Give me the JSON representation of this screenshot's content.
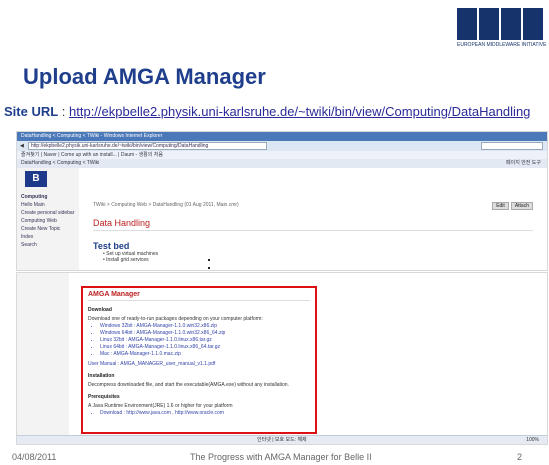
{
  "slide": {
    "title": "Upload AMGA Manager",
    "site_label": "Site URL",
    "site_sep": " : ",
    "site_url": "http://ekpbelle2.physik.uni-karlsruhe.de/~twiki/bin/view/Computing/DataHandling",
    "logo_text": "EUROPEAN MIDDLEWARE INITIATIVE",
    "footer_date": "04/08/2011",
    "footer_title": "The Progress with AMGA Manager for Belle II",
    "page_number": "2"
  },
  "browser": {
    "titlebar": "DataHandling < Computing < TWiki - Windows Internet Explorer",
    "url": "http://ekpbelle2.physik.uni-karlsruhe.de/~twiki/bin/view/Computing/DataHandling",
    "favorites": "즐겨찾기  |  Naver  |  Come up with an install...  |  Daum - 생활의 처음",
    "tab": "DataHandling < Computing < TWiki",
    "tools": "페이지  안전  도구"
  },
  "twiki": {
    "web": "Computing",
    "hello": "Hello Main",
    "create": "Create personal sidebar",
    "web_links": [
      "Computing Web",
      "Create New Topic",
      "Index",
      "Search"
    ],
    "breadcrumb": "TWiki > Computing Web > DataHandling (01 Aug 2011, Main.cmr)",
    "edit": "Edit",
    "attach": "Attach",
    "topic": "Data Handling",
    "testbed": "Test bed",
    "testbed_items": [
      "Set up virtual machines",
      "Install grid services"
    ]
  },
  "amga": {
    "heading": "AMGA Manager",
    "download": "Download",
    "download_intro": "Download one of ready-to-run packages depending on your computer platform:",
    "packages": [
      "Windows 32bit : AMGA-Manager-1.1.0.win32.x86.zip",
      "Windows 64bit : AMGA-Manager-1.1.0.win32.x86_64.zip",
      "Linux 32bit : AMGA-Manager-1.1.0.linux.x86.tar.gz",
      "Linux 64bit : AMGA-Manager-1.1.0.linux.x86_64.tar.gz",
      "Mac : AMGA-Manager-1.1.0.mac.zip"
    ],
    "user_manual": "User Manual : AMGA_MANAGER_user_manual_v1.1.pdf",
    "installation": "Installation",
    "install_text": "Decompress downloaded file, and start the executable(AMGA.exe) without any installation.",
    "prerequisites": "Prerequisites",
    "prereq_text": "A Java Runtime Environment(JRE) 1.6 or higher for your platform",
    "prereq_download": "Download : http://www.java.com , http://www.oracle.com",
    "status_zone": "인터넷 | 보호 모드: 해제",
    "zoom": "100%"
  }
}
